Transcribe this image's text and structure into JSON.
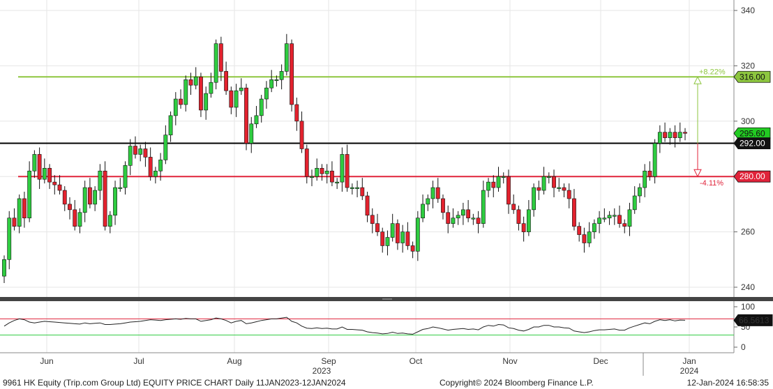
{
  "chart_data": {
    "type": "candlestick",
    "price_panel": {
      "ylim": [
        235,
        345
      ],
      "y_ticks": [
        "340",
        "320",
        "300",
        "260",
        "240"
      ],
      "candles_close_approx": [
        250,
        265,
        262,
        272,
        265,
        282,
        288,
        279,
        283,
        278,
        277,
        275,
        270,
        268,
        262,
        267,
        276,
        270,
        275,
        282,
        262,
        266,
        276,
        276,
        284,
        291,
        288,
        290,
        287,
        280,
        282,
        286,
        295,
        302,
        308,
        306,
        315,
        313,
        316,
        304,
        310,
        314,
        328,
        318,
        311,
        305,
        311,
        312,
        292,
        299,
        302,
        308,
        312,
        315,
        315,
        318,
        328,
        306,
        300,
        290,
        280,
        280,
        283,
        281,
        282,
        278,
        278,
        288,
        276,
        276,
        276,
        273,
        266,
        263,
        260,
        255,
        258,
        263,
        256,
        260,
        255,
        253,
        265,
        270,
        272,
        276,
        272,
        267,
        263,
        265,
        266,
        268,
        265,
        265,
        263,
        275,
        278,
        276,
        280,
        280,
        270,
        268,
        263,
        260,
        268,
        276,
        275,
        280,
        280,
        276,
        276,
        275,
        272,
        262,
        259,
        256,
        260,
        263,
        265,
        265,
        266,
        266,
        263,
        262,
        268,
        273,
        276,
        282,
        280,
        292,
        296,
        294,
        296,
        294,
        296,
        295.6
      ],
      "levels": [
        {
          "name": "resistance",
          "value": 316.0,
          "label": "316.00",
          "color": "#8dc63f",
          "pct": "+8.22%"
        },
        {
          "name": "last-price-line",
          "value": 292.0,
          "label": "292.00",
          "color": "#000000"
        },
        {
          "name": "support",
          "value": 280.0,
          "label": "280.00",
          "color": "#e0233a",
          "pct": "-4.11%"
        }
      ],
      "last_price": {
        "value": 295.6,
        "label": "295.60",
        "color": "#22cc22"
      }
    },
    "rsi_panel": {
      "ylim": [
        -5,
        105
      ],
      "y_ticks": [
        "100",
        "50",
        "0"
      ],
      "upper": 70,
      "lower": 30,
      "values": [
        52,
        60,
        66,
        70,
        68,
        62,
        60,
        62,
        64,
        63,
        62,
        61,
        60,
        59,
        58,
        57,
        60,
        58,
        59,
        60,
        56,
        56,
        57,
        58,
        60,
        62,
        63,
        64,
        66,
        68,
        67,
        66,
        68,
        69,
        70,
        69,
        71,
        70,
        70,
        64,
        66,
        68,
        72,
        70,
        66,
        60,
        64,
        66,
        58,
        60,
        63,
        66,
        68,
        70,
        70,
        72,
        74,
        64,
        60,
        52,
        47,
        46,
        48,
        46,
        47,
        45,
        45,
        50,
        44,
        44,
        43,
        42,
        38,
        36,
        35,
        33,
        34,
        37,
        34,
        35,
        33,
        32,
        38,
        44,
        46,
        50,
        48,
        45,
        42,
        44,
        45,
        46,
        44,
        45,
        43,
        50,
        54,
        52,
        56,
        55,
        48,
        46,
        42,
        40,
        44,
        50,
        50,
        54,
        54,
        50,
        50,
        48,
        47,
        40,
        38,
        36,
        38,
        41,
        43,
        43,
        44,
        45,
        42,
        42,
        48,
        52,
        56,
        60,
        58,
        64,
        68,
        66,
        68,
        65,
        67,
        66.5613
      ],
      "last_label": "66.5613"
    },
    "x_labels": [
      {
        "label": "Jun",
        "sub": ""
      },
      {
        "label": "Jul",
        "sub": ""
      },
      {
        "label": "Aug",
        "sub": ""
      },
      {
        "label": "Sep",
        "sub": "2023"
      },
      {
        "label": "Oct",
        "sub": ""
      },
      {
        "label": "Nov",
        "sub": ""
      },
      {
        "label": "Dec",
        "sub": ""
      },
      {
        "label": "Jan",
        "sub": "2024"
      }
    ],
    "colors": {
      "up": "#2ecc40",
      "down": "#e3222e",
      "grid": "#e6e6e6"
    }
  },
  "footer": {
    "left": "9961 HK Equity (Trip.com Group Ltd) EQUITY PRICE CHART  Daily 11JAN2023-12JAN2024",
    "center": "Copyright© 2024 Bloomberg Finance L.P.",
    "right": "12-Jan-2024 16:58:35"
  }
}
